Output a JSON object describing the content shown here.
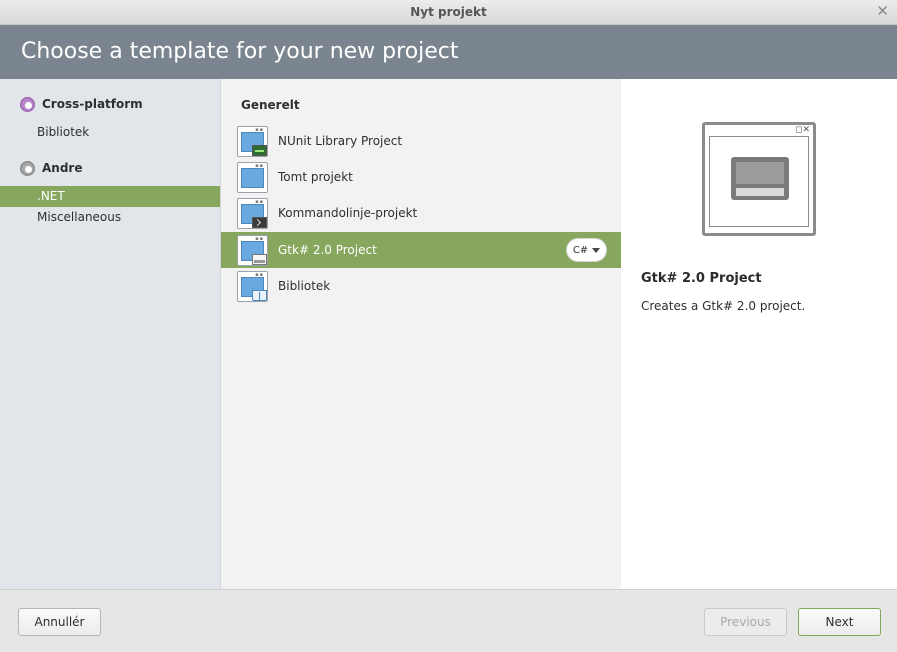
{
  "window": {
    "title": "Nyt projekt",
    "close_glyph": "✕"
  },
  "header": {
    "title": "Choose a template for your new project"
  },
  "sidebar": {
    "categories": [
      {
        "label": "Cross-platform",
        "icon": "category-ring-icon",
        "subitems": [
          {
            "label": "Bibliotek"
          }
        ]
      },
      {
        "label": "Andre",
        "icon": "category-ring-icon",
        "subitems": [
          {
            "label": ".NET",
            "selected": true
          },
          {
            "label": "Miscellaneous"
          }
        ]
      }
    ]
  },
  "templates": {
    "section": "Generelt",
    "items": [
      {
        "name": "NUnit Library Project",
        "icon": "nunit-project-icon"
      },
      {
        "name": "Tomt projekt",
        "icon": "empty-project-icon"
      },
      {
        "name": "Kommandolinje-projekt",
        "icon": "console-project-icon"
      },
      {
        "name": "Gtk# 2.0 Project",
        "icon": "gtk-project-icon",
        "selected": true,
        "language": "C#"
      },
      {
        "name": "Bibliotek",
        "icon": "library-project-icon"
      }
    ]
  },
  "details": {
    "title": "Gtk# 2.0 Project",
    "description": "Creates a Gtk# 2.0 project.",
    "preview_icon": "gtk-window-preview-icon",
    "preview_buttons": "◻✕"
  },
  "footer": {
    "cancel_label": "Annullér",
    "previous_label": "Previous",
    "next_label": "Next"
  },
  "colors": {
    "header_bg": "#7b858f",
    "selection": "#87a65e",
    "sidebar_bg": "#e2e5e9"
  }
}
